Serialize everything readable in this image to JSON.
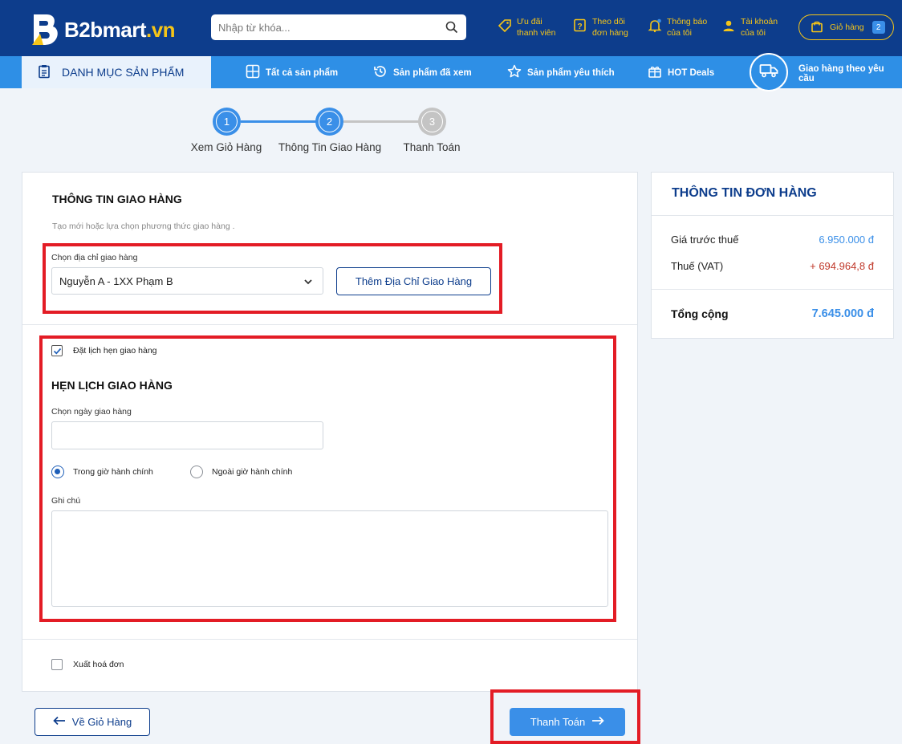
{
  "header": {
    "logo_text": "B2bmart",
    "logo_domain": ".vn",
    "search_placeholder": "Nhập từ khóa...",
    "items": [
      {
        "line1": "Ưu đãi",
        "line2": "thanh viên",
        "icon": "tag-icon"
      },
      {
        "line1": "Theo dõi",
        "line2": "đơn hàng",
        "icon": "order-help-icon"
      },
      {
        "line1": "Thông báo",
        "line2": "của tôi",
        "icon": "bell-icon"
      },
      {
        "line1": "Tài khoản",
        "line2": "của tôi",
        "icon": "user-icon"
      }
    ],
    "cart_label": "Giỏ hàng",
    "cart_count": "2"
  },
  "nav": {
    "category": "DANH MỤC SẢN PHẨM",
    "items": [
      {
        "label": "Tất cả sản phẩm",
        "icon": "grid-plus-icon"
      },
      {
        "label": "Sản phẩm đã xem",
        "icon": "history-icon"
      },
      {
        "label": "Sản phẩm yêu thích",
        "icon": "star-icon"
      },
      {
        "label": "HOT Deals",
        "icon": "gift-icon"
      }
    ],
    "delivery": "Giao hàng theo yêu cầu"
  },
  "stepper": [
    {
      "num": "1",
      "label": "Xem Giỏ Hàng",
      "state": "done"
    },
    {
      "num": "2",
      "label": "Thông Tin Giao Hàng",
      "state": "active"
    },
    {
      "num": "3",
      "label": "Thanh Toán",
      "state": "pending"
    }
  ],
  "shipping": {
    "title": "THÔNG TIN GIAO HÀNG",
    "subtitle": "Tạo mới hoặc lựa chọn phương thức giao hàng .",
    "address_label": "Chọn địa chỉ giao hàng",
    "address_value": "Nguyễn A - 1XX Phạm B",
    "add_address_button": "Thêm Địa Chỉ Giao Hàng",
    "schedule_checkbox": "Đặt lịch hẹn giao hàng",
    "schedule_checked": true,
    "schedule_title": "HẸN LỊCH GIAO HÀNG",
    "date_label": "Chọn ngày giao hàng",
    "date_value": "",
    "radio_office": "Trong giờ hành chính",
    "radio_outside": "Ngoài giờ hành chính",
    "note_label": "Ghi chú",
    "note_value": "",
    "invoice_checkbox": "Xuất hoá đơn",
    "invoice_checked": false
  },
  "buttons": {
    "back": "Về Giỏ Hàng",
    "pay": "Thanh Toán"
  },
  "order": {
    "title": "THÔNG TIN ĐƠN HÀNG",
    "pretax_label": "Giá trước thuế",
    "pretax_value": "6.950.000 đ",
    "vat_label": "Thuế (VAT)",
    "vat_value": "+ 694.964,8 đ",
    "total_label": "Tổng cộng",
    "total_value": "7.645.000 đ"
  },
  "colors": {
    "header_bg": "#0d3d8c",
    "nav_bg": "#2e8fe6",
    "accent_yellow": "#f5c518",
    "highlight_red": "#e31c25",
    "vat_red": "#c0392b",
    "pretax_blue": "#3a8fe8"
  }
}
